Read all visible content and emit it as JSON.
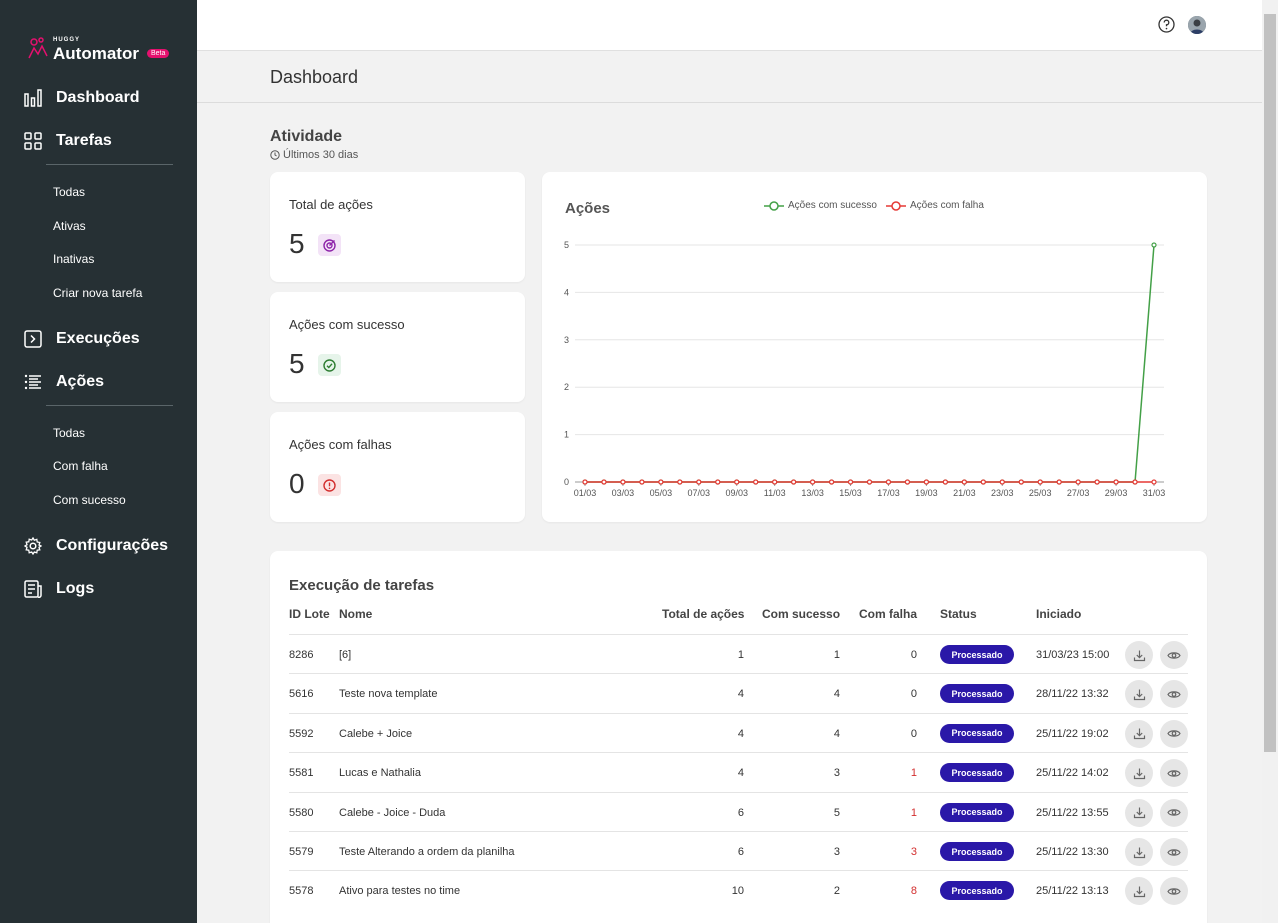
{
  "brand": {
    "huggy": "HUGGY",
    "name": "Automator",
    "beta": "Beta"
  },
  "sidebar": {
    "main": [
      {
        "label": "Dashboard",
        "icon": "bar-chart-icon"
      },
      {
        "label": "Tarefas",
        "icon": "grid-icon"
      },
      {
        "label": "Execuções",
        "icon": "terminal-icon"
      },
      {
        "label": "Ações",
        "icon": "list-icon"
      },
      {
        "label": "Configurações",
        "icon": "gear-icon"
      },
      {
        "label": "Logs",
        "icon": "document-icon"
      }
    ],
    "tarefas_sub": [
      "Todas",
      "Ativas",
      "Inativas",
      "Criar nova tarefa"
    ],
    "acoes_sub": [
      "Todas",
      "Com falha",
      "Com sucesso"
    ]
  },
  "page": {
    "title": "Dashboard"
  },
  "activity": {
    "title": "Atividade",
    "period": "Últimos 30 dias",
    "stats": [
      {
        "label": "Total de ações",
        "value": "5",
        "icon": "target-icon",
        "color": "#8e24aa",
        "bg": "#f3e3f7"
      },
      {
        "label": "Ações com sucesso",
        "value": "5",
        "icon": "check-circle-icon",
        "color": "#2e7d32",
        "bg": "#e6f4ea"
      },
      {
        "label": "Ações com falhas",
        "value": "0",
        "icon": "alert-circle-icon",
        "color": "#d32f2f",
        "bg": "#fbe3e3"
      }
    ]
  },
  "chart_data": {
    "type": "line",
    "title": "Ações",
    "x": [
      "01/03",
      "02/03",
      "03/03",
      "04/03",
      "05/03",
      "06/03",
      "07/03",
      "08/03",
      "09/03",
      "10/03",
      "11/03",
      "12/03",
      "13/03",
      "14/03",
      "15/03",
      "16/03",
      "17/03",
      "18/03",
      "19/03",
      "20/03",
      "21/03",
      "22/03",
      "23/03",
      "24/03",
      "25/03",
      "26/03",
      "27/03",
      "28/03",
      "29/03",
      "30/03",
      "31/03"
    ],
    "x_tick_labels": [
      "01/03",
      "03/03",
      "05/03",
      "07/03",
      "09/03",
      "11/03",
      "13/03",
      "15/03",
      "17/03",
      "19/03",
      "21/03",
      "23/03",
      "25/03",
      "27/03",
      "29/03",
      "31/03"
    ],
    "ylim": [
      0,
      5
    ],
    "y_ticks": [
      "0",
      "1",
      "2",
      "3",
      "4",
      "5"
    ],
    "grid": true,
    "legend": "top",
    "series": [
      {
        "name": "Ações com sucesso",
        "color": "#43a047",
        "values": [
          0,
          0,
          0,
          0,
          0,
          0,
          0,
          0,
          0,
          0,
          0,
          0,
          0,
          0,
          0,
          0,
          0,
          0,
          0,
          0,
          0,
          0,
          0,
          0,
          0,
          0,
          0,
          0,
          0,
          0,
          5
        ]
      },
      {
        "name": "Ações com falha",
        "color": "#e53935",
        "values": [
          0,
          0,
          0,
          0,
          0,
          0,
          0,
          0,
          0,
          0,
          0,
          0,
          0,
          0,
          0,
          0,
          0,
          0,
          0,
          0,
          0,
          0,
          0,
          0,
          0,
          0,
          0,
          0,
          0,
          0,
          0
        ]
      }
    ]
  },
  "table": {
    "title": "Execução de tarefas",
    "columns": [
      "ID Lote",
      "Nome",
      "Total de ações",
      "Com sucesso",
      "Com falha",
      "Status",
      "Iniciado"
    ],
    "rows": [
      {
        "id": "8286",
        "name": "[6]",
        "total": "1",
        "success": "1",
        "fail": "0",
        "status": "Processado",
        "started": "31/03/23 15:00"
      },
      {
        "id": "5616",
        "name": "Teste nova template",
        "total": "4",
        "success": "4",
        "fail": "0",
        "status": "Processado",
        "started": "28/11/22 13:32"
      },
      {
        "id": "5592",
        "name": "Calebe + Joice",
        "total": "4",
        "success": "4",
        "fail": "0",
        "status": "Processado",
        "started": "25/11/22 19:02"
      },
      {
        "id": "5581",
        "name": "Lucas e Nathalia",
        "total": "4",
        "success": "3",
        "fail": "1",
        "status": "Processado",
        "started": "25/11/22 14:02"
      },
      {
        "id": "5580",
        "name": "Calebe - Joice - Duda",
        "total": "6",
        "success": "5",
        "fail": "1",
        "status": "Processado",
        "started": "25/11/22 13:55"
      },
      {
        "id": "5579",
        "name": "Teste Alterando a ordem da planilha",
        "total": "6",
        "success": "3",
        "fail": "3",
        "status": "Processado",
        "started": "25/11/22 13:30"
      },
      {
        "id": "5578",
        "name": "Ativo para testes no time",
        "total": "10",
        "success": "2",
        "fail": "8",
        "status": "Processado",
        "started": "25/11/22 13:13"
      }
    ]
  }
}
